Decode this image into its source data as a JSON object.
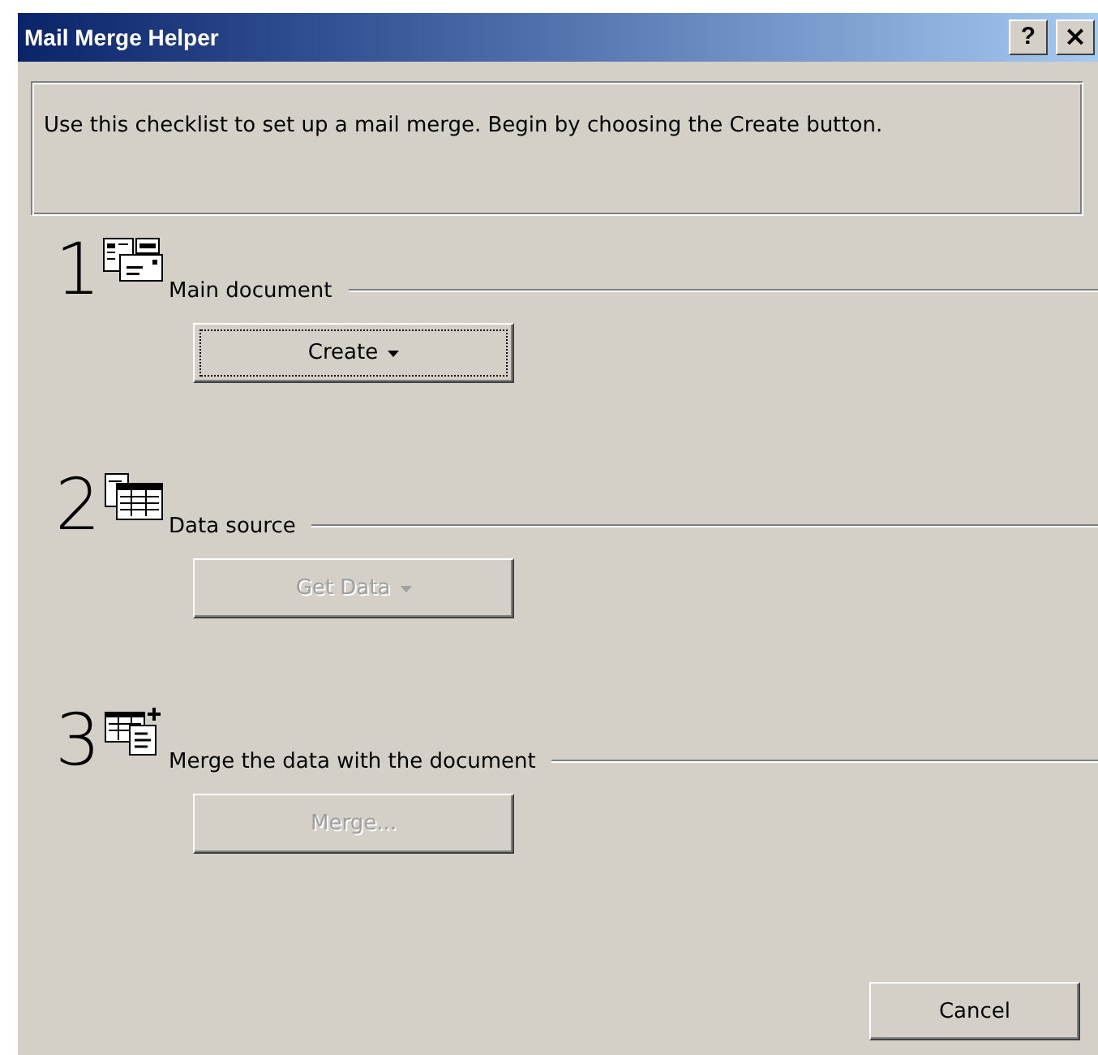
{
  "window": {
    "title": "Mail Merge Helper",
    "title_buttons": [
      {
        "kind": "help",
        "label": "?"
      },
      {
        "kind": "close",
        "label": "×"
      }
    ]
  },
  "instructions": "Use this checklist to set up a mail merge. Begin by choosing the Create button.",
  "steps": [
    {
      "number": "1",
      "kind": "document",
      "label": "Main document",
      "button": {
        "label": "Create",
        "has_menu": true,
        "disabled": false,
        "focused": true
      }
    },
    {
      "number": "2",
      "kind": "data",
      "label": "Data source",
      "button": {
        "label": "Get Data",
        "has_menu": true,
        "disabled": true,
        "focused": false
      }
    },
    {
      "number": "3",
      "kind": "merge",
      "label": "Merge the data with the document",
      "button": {
        "label": "Merge...",
        "has_menu": false,
        "disabled": true,
        "focused": false
      }
    }
  ],
  "buttons": [
    {
      "label": "Cancel",
      "disabled": false
    }
  ]
}
